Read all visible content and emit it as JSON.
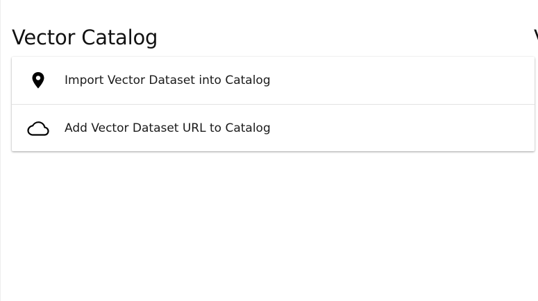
{
  "catalog": {
    "title": "Vector Catalog",
    "next_section_title_peek": "V",
    "items": [
      {
        "label": "Import Vector Dataset into Catalog",
        "icon": "location-pin-icon"
      },
      {
        "label": "Add Vector Dataset URL to Catalog",
        "icon": "cloud-icon"
      }
    ]
  }
}
